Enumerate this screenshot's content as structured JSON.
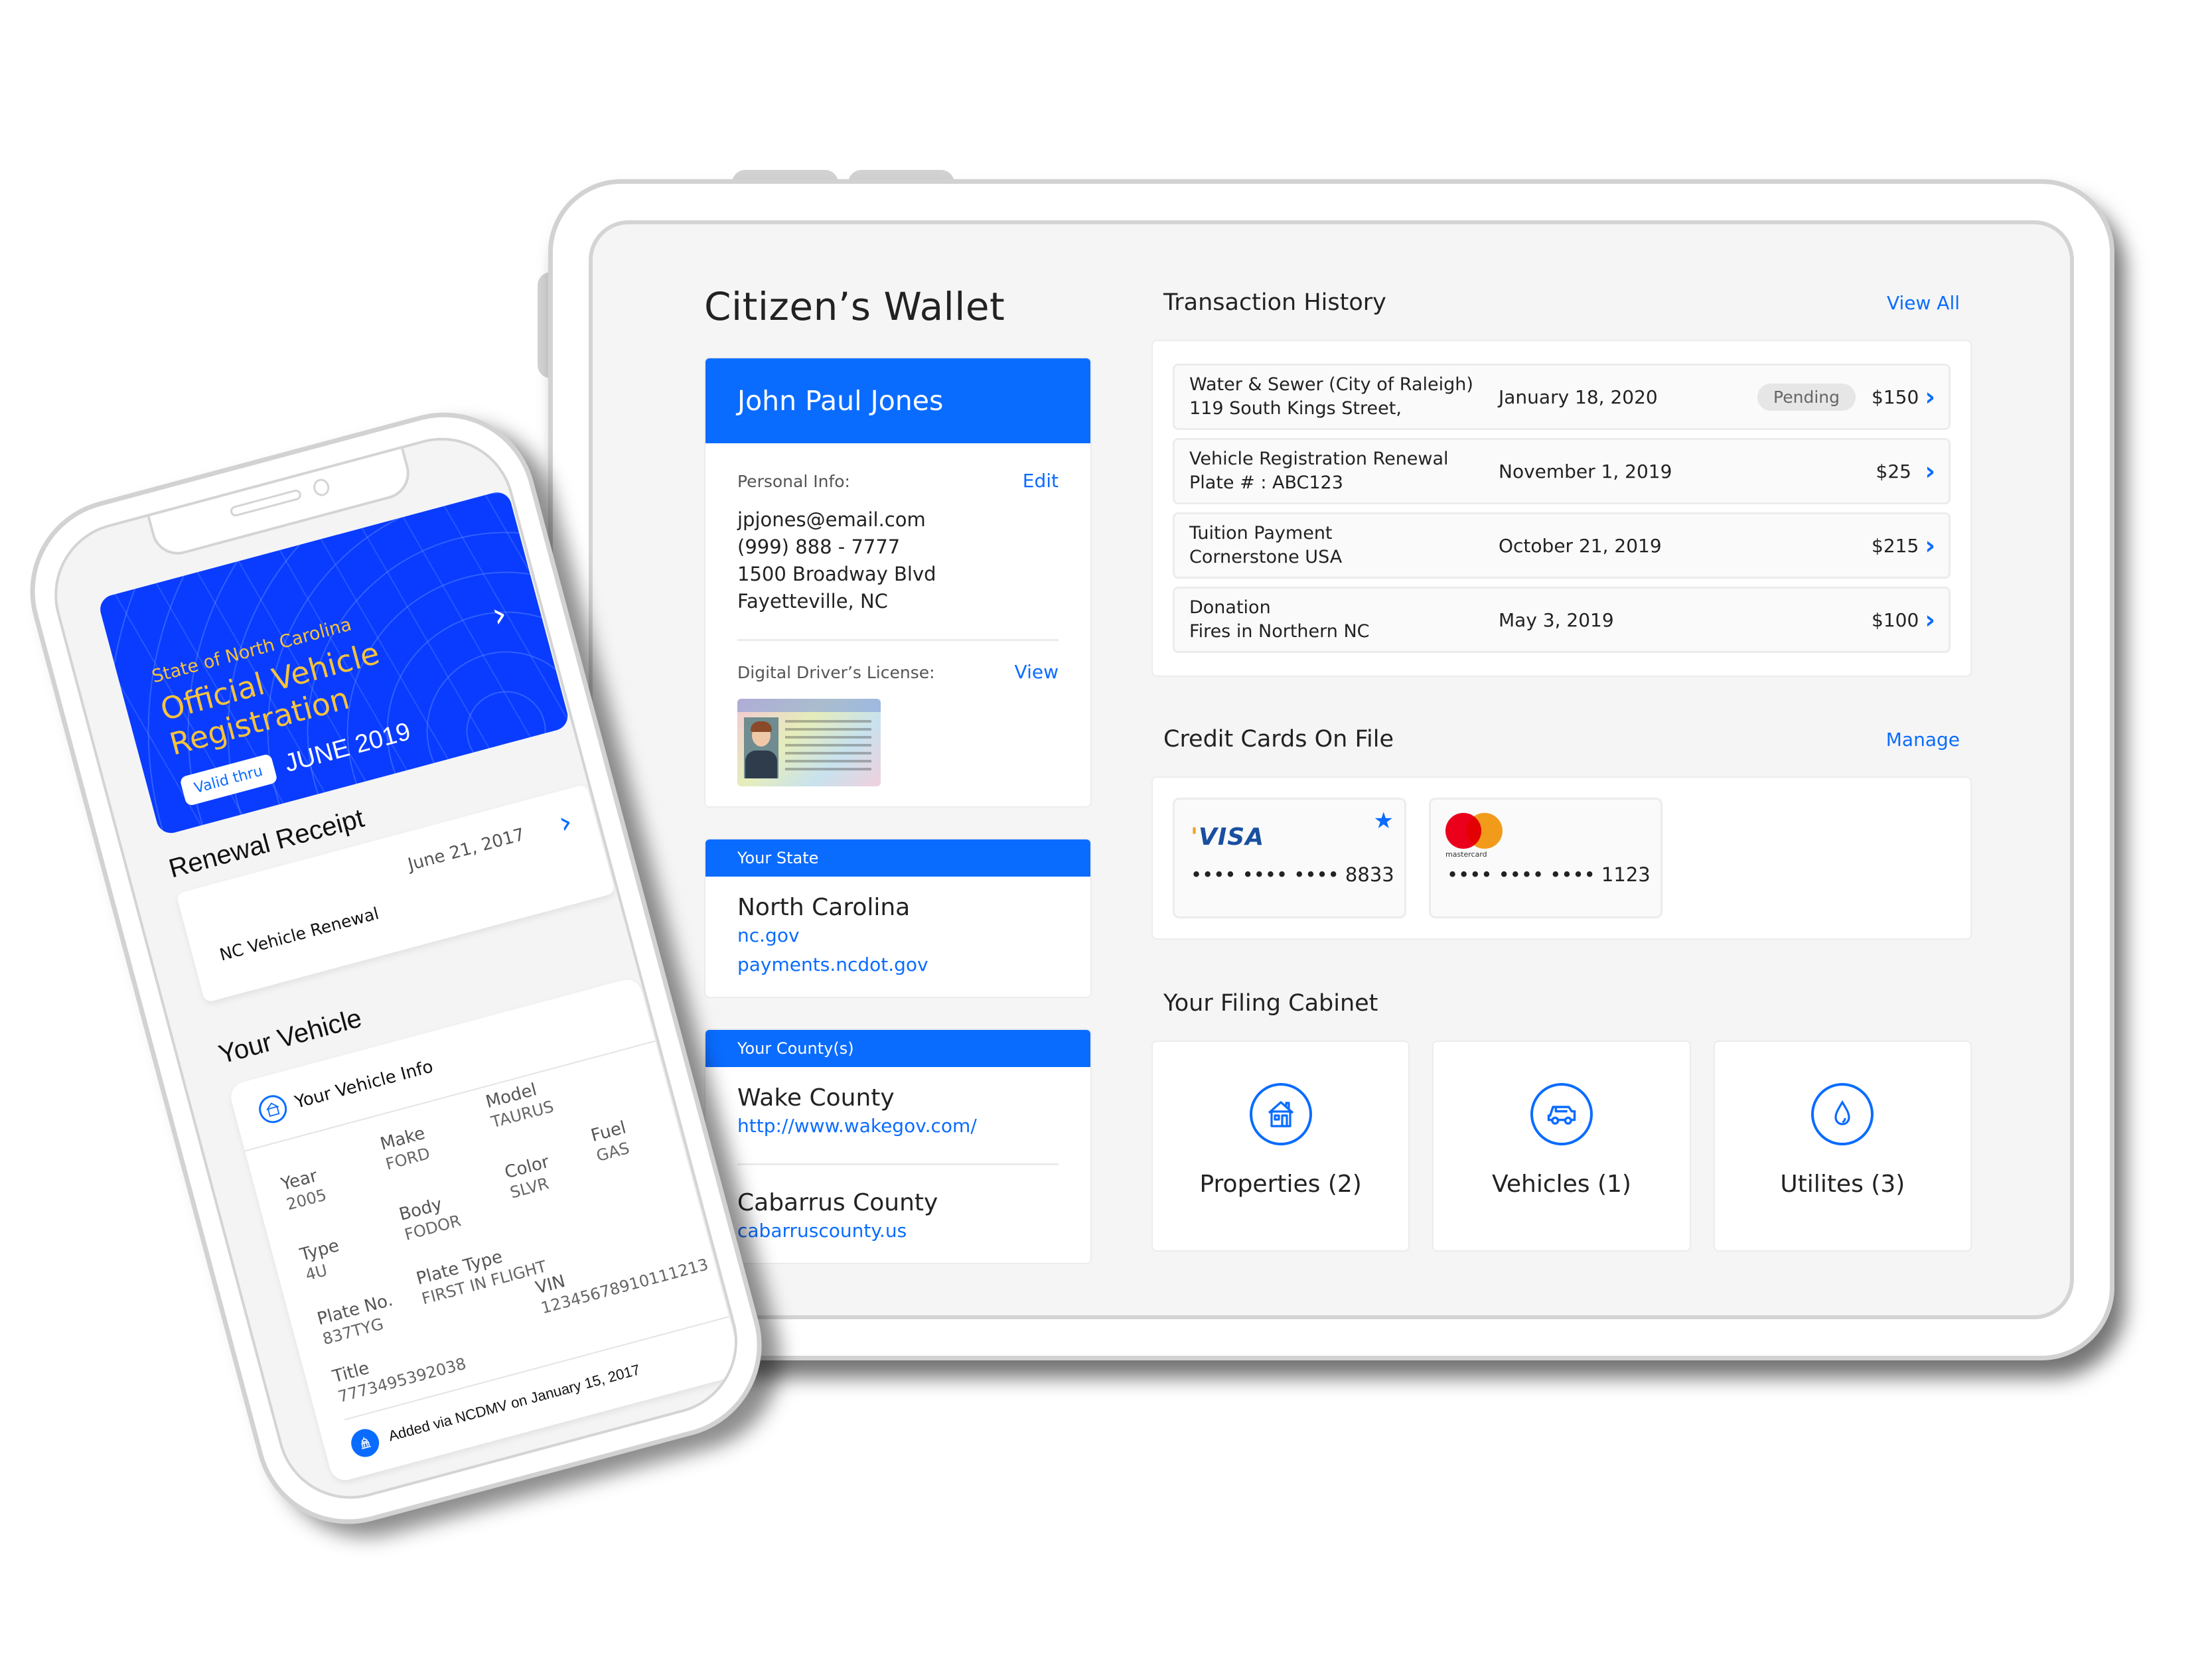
{
  "tablet": {
    "app_title": "Citizen’s Wallet",
    "profile": {
      "name": "John Paul Jones",
      "personal_info_label": "Personal Info:",
      "edit_label": "Edit",
      "email": "jpjones@email.com",
      "phone": "(999) 888 - 7777",
      "address_line1": "1500 Broadway Blvd",
      "address_line2": "Fayetteville, NC",
      "license_label": "Digital Driver’s License:",
      "view_label": "View"
    },
    "state": {
      "header": "Your State",
      "name": "North Carolina",
      "links": [
        "nc.gov",
        "payments.ncdot.gov"
      ]
    },
    "counties": {
      "header": "Your County(s)",
      "items": [
        {
          "name": "Wake County",
          "link": "http://www.wakegov.com/"
        },
        {
          "name": "Cabarrus County",
          "link": "cabarruscounty.us"
        }
      ]
    },
    "transactions": {
      "title": "Transaction History",
      "view_all_label": "View All",
      "rows": [
        {
          "line1": "Water & Sewer (City of Raleigh)",
          "line2": "119 South Kings Street,",
          "date": "January 18, 2020",
          "status": "Pending",
          "amount": "$150"
        },
        {
          "line1": "Vehicle Registration Renewal",
          "line2": "Plate # : ABC123",
          "date": "November 1, 2019",
          "status": "",
          "amount": "$25"
        },
        {
          "line1": "Tuition Payment",
          "line2": "Cornerstone USA",
          "date": "October 21, 2019",
          "status": "",
          "amount": "$215"
        },
        {
          "line1": "Donation",
          "line2": "Fires in Northern NC",
          "date": "May 3, 2019",
          "status": "",
          "amount": "$100"
        }
      ]
    },
    "credit_cards": {
      "title": "Credit Cards On File",
      "manage_label": "Manage",
      "cards": [
        {
          "brand": "VISA",
          "number": "•••• •••• •••• 8833",
          "favorite": true
        },
        {
          "brand": "mastercard",
          "number": "•••• •••• •••• 1123",
          "favorite": false
        }
      ]
    },
    "filing_cabinet": {
      "title": "Your Filing Cabinet",
      "items": [
        {
          "label": "Properties (2)",
          "icon": "house-icon"
        },
        {
          "label": "Vehicles (1)",
          "icon": "car-icon"
        },
        {
          "label": "Utilites (3)",
          "icon": "water-drop-icon"
        }
      ]
    }
  },
  "phone": {
    "registration_card": {
      "subtitle": "State of North Carolina",
      "title_line1": "Official Vehicle",
      "title_line2": "Registration",
      "valid_label": "Valid thru",
      "valid_date": "JUNE 2019"
    },
    "renewal_receipt": {
      "title": "Renewal Receipt",
      "name": "NC Vehicle Renewal",
      "date": "June 21, 2017"
    },
    "your_vehicle": {
      "title": "Your Vehicle",
      "info_title": "Your Vehicle Info",
      "fields": {
        "year": {
          "label": "Year",
          "value": "2005"
        },
        "make": {
          "label": "Make",
          "value": "FORD"
        },
        "model": {
          "label": "Model",
          "value": "TAURUS"
        },
        "type": {
          "label": "Type",
          "value": "4U"
        },
        "body": {
          "label": "Body",
          "value": "FODOR"
        },
        "color": {
          "label": "Color",
          "value": "SLVR"
        },
        "fuel": {
          "label": "Fuel",
          "value": "GAS"
        },
        "plate_no": {
          "label": "Plate No.",
          "value": "837TYG"
        },
        "plate_type": {
          "label": "Plate Type",
          "value": "FIRST IN FLIGHT"
        },
        "vin": {
          "label": "VIN",
          "value": "12345678910111213"
        },
        "title": {
          "label": "Title",
          "value": "7773495392038"
        }
      },
      "footer": "Added via NCDMV on January 15, 2017"
    }
  },
  "colors": {
    "accent": "#0a6cff",
    "registration_card": "#0a3cff",
    "registration_text": "#f7c33b",
    "pending_pill": "#e6e6e6"
  }
}
